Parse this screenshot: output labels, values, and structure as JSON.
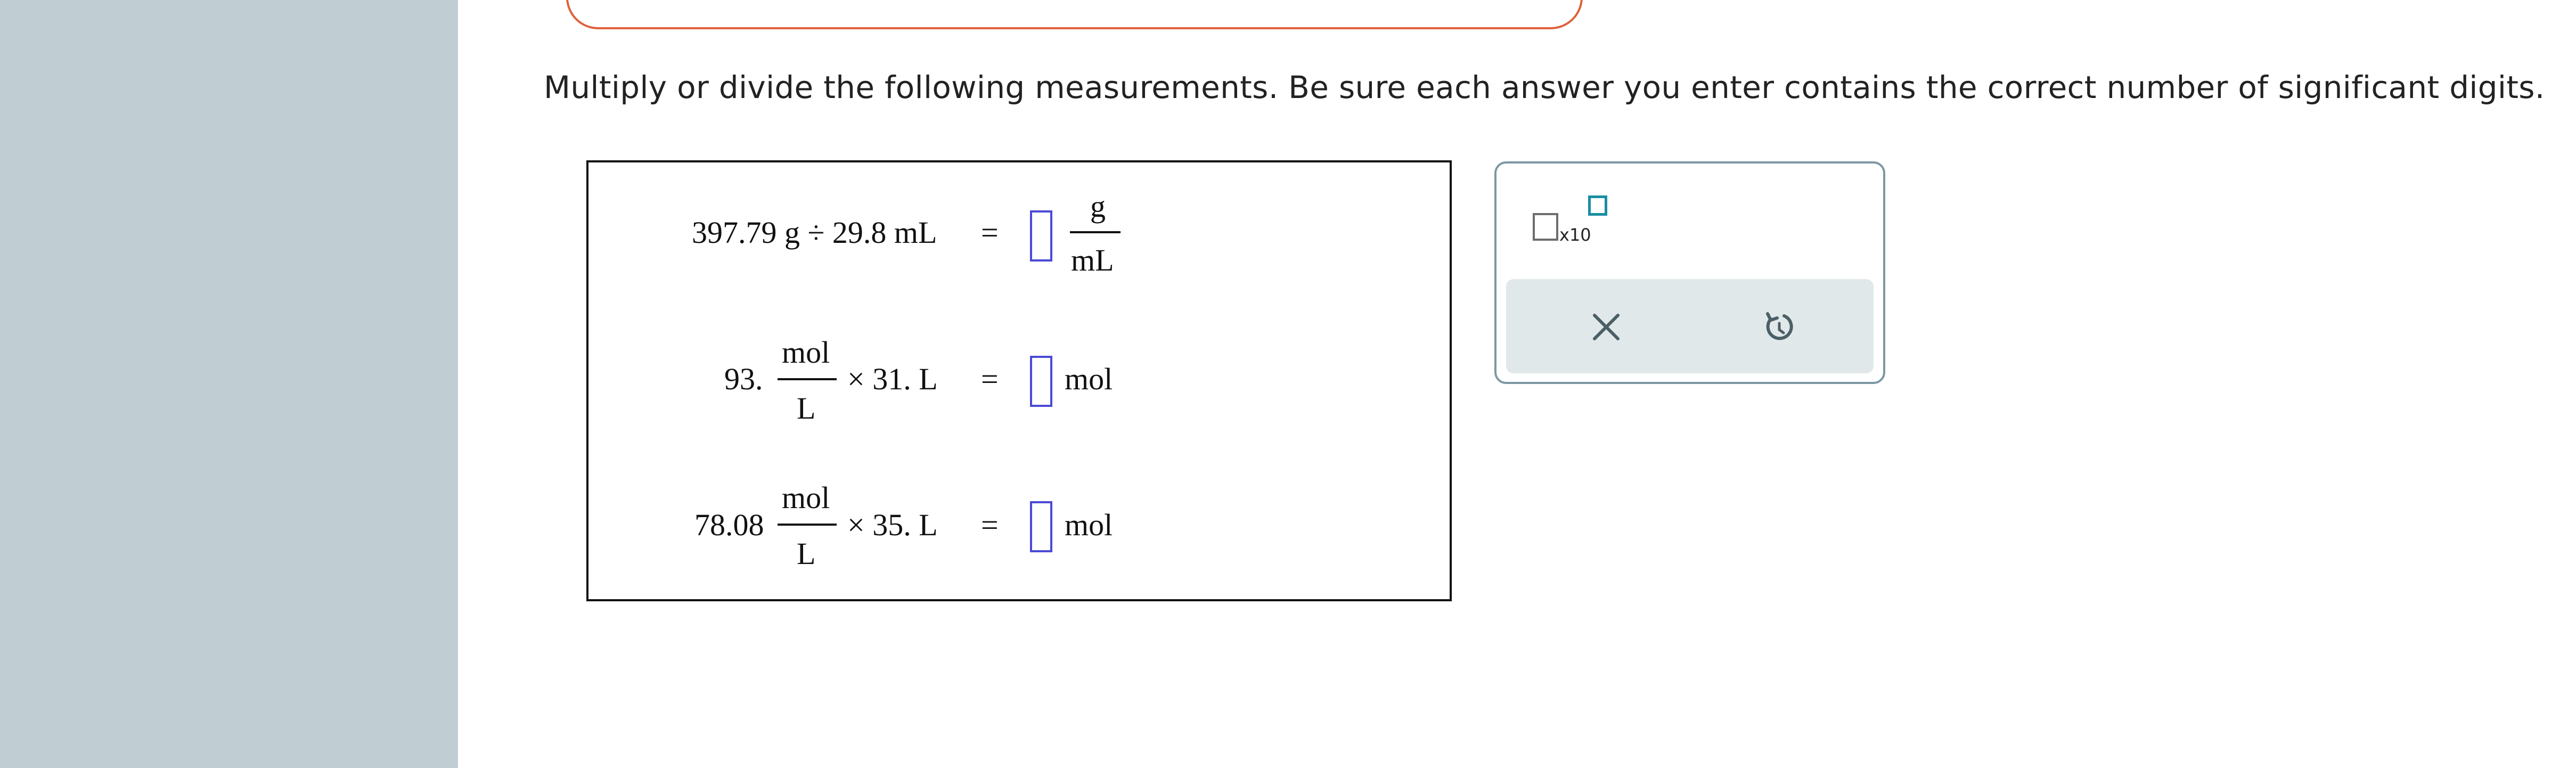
{
  "instructions": "Multiply or divide the following measurements. Be sure each answer you enter contains the correct number of significant digits.",
  "problems": [
    {
      "left": "397.79 g ÷ 29.8 mL",
      "equals": "=",
      "unit_numerator": "g",
      "unit_denominator": "mL",
      "answer_value": ""
    },
    {
      "coefficient": "93.",
      "frac_numerator": "mol",
      "frac_denominator": "L",
      "multiplier": "× 31. L",
      "equals": "=",
      "unit": "mol",
      "answer_value": ""
    },
    {
      "coefficient": "78.08",
      "frac_numerator": "mol",
      "frac_denominator": "L",
      "multiplier": "× 35. L",
      "equals": "=",
      "unit": "mol",
      "answer_value": ""
    }
  ],
  "tools": {
    "sci_notation_label": "x10",
    "clear_icon": "close-icon",
    "undo_icon": "undo-icon"
  },
  "colors": {
    "sidebar": "#c0ced3",
    "panel_border_accent": "#e0613c",
    "answer_box_border": "#4a4ad6",
    "tool_panel_border": "#7c98a3",
    "exponent_box": "#178ea0",
    "tool_bar_bg": "#e1e8ea"
  }
}
